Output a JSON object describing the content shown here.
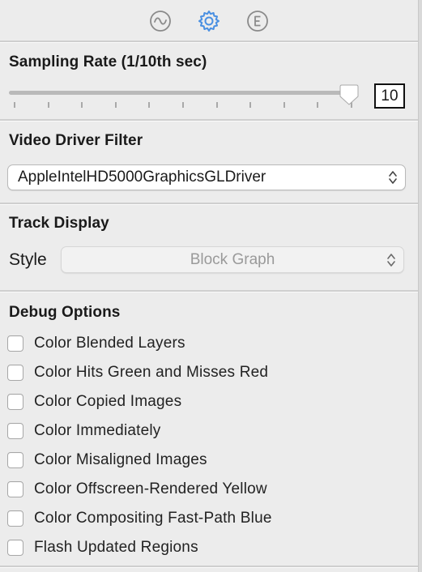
{
  "tabs": [
    {
      "icon": "waveform-icon",
      "active": false
    },
    {
      "icon": "gear-icon",
      "active": true
    },
    {
      "icon": "e-circle-icon",
      "active": false
    }
  ],
  "accent_color": "#4a90e2",
  "sampling": {
    "title": "Sampling Rate (1/10th sec)",
    "value": "10",
    "slider_value": 10,
    "slider_max": 10
  },
  "video_driver": {
    "title": "Video Driver Filter",
    "selected": "AppleIntelHD5000GraphicsGLDriver"
  },
  "track_display": {
    "title": "Track Display",
    "style_label": "Style",
    "style_selected": "Block Graph"
  },
  "debug": {
    "title": "Debug Options",
    "options": [
      {
        "label": "Color Blended Layers",
        "checked": false
      },
      {
        "label": "Color Hits Green and Misses Red",
        "checked": false
      },
      {
        "label": "Color Copied Images",
        "checked": false
      },
      {
        "label": "Color Immediately",
        "checked": false
      },
      {
        "label": "Color Misaligned Images",
        "checked": false
      },
      {
        "label": "Color Offscreen-Rendered Yellow",
        "checked": false
      },
      {
        "label": "Color Compositing Fast-Path Blue",
        "checked": false
      },
      {
        "label": "Flash Updated Regions",
        "checked": false
      }
    ]
  }
}
